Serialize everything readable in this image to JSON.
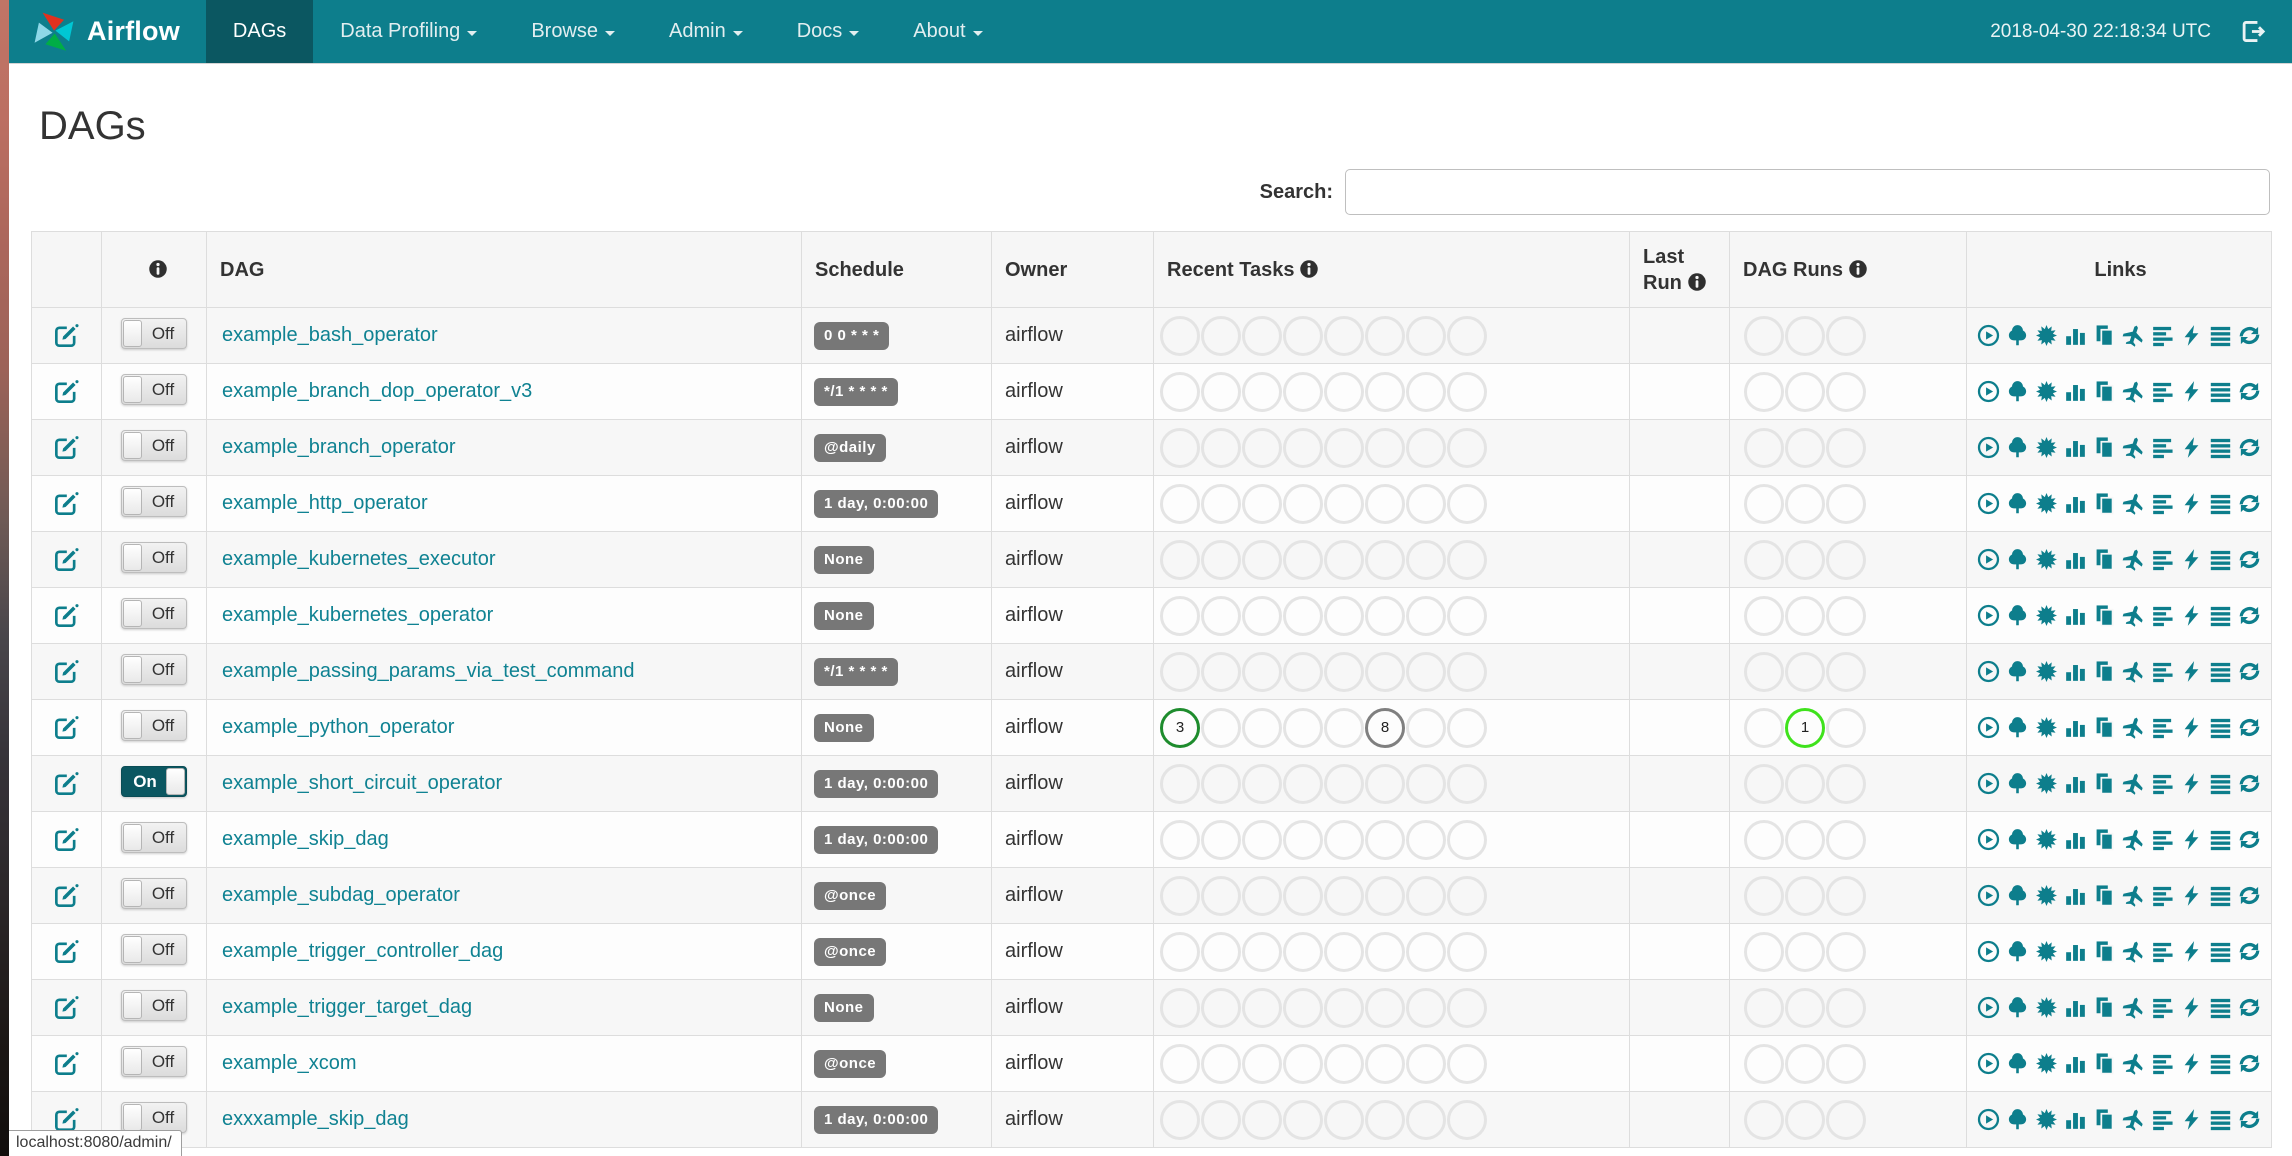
{
  "navbar": {
    "brand": "Airflow",
    "items": [
      {
        "label": "DAGs",
        "active": true,
        "dropdown": false
      },
      {
        "label": "Data Profiling",
        "active": false,
        "dropdown": true
      },
      {
        "label": "Browse",
        "active": false,
        "dropdown": true
      },
      {
        "label": "Admin",
        "active": false,
        "dropdown": true
      },
      {
        "label": "Docs",
        "active": false,
        "dropdown": true
      },
      {
        "label": "About",
        "active": false,
        "dropdown": true
      }
    ],
    "clock": "2018-04-30 22:18:34 UTC"
  },
  "page": {
    "title": "DAGs",
    "search_label": "Search:",
    "search_value": "",
    "status_bar": "localhost:8080/admin/"
  },
  "table": {
    "headers": {
      "dag": "DAG",
      "schedule": "Schedule",
      "owner": "Owner",
      "recent_tasks": "Recent Tasks",
      "last_run": "Last Run",
      "dag_runs": "DAG Runs",
      "links": "Links"
    },
    "recent_task_slots": 8,
    "dag_run_slots": 3,
    "rows": [
      {
        "name": "example_bash_operator",
        "schedule": "0 0 * * *",
        "owner": "airflow",
        "paused": true,
        "toggle_label": "Off",
        "last_run": "",
        "recent_tasks": [
          null,
          null,
          null,
          null,
          null,
          null,
          null,
          null
        ],
        "dag_runs": [
          null,
          null,
          null
        ]
      },
      {
        "name": "example_branch_dop_operator_v3",
        "schedule": "*/1 * * * *",
        "owner": "airflow",
        "paused": true,
        "toggle_label": "Off",
        "last_run": "",
        "recent_tasks": [
          null,
          null,
          null,
          null,
          null,
          null,
          null,
          null
        ],
        "dag_runs": [
          null,
          null,
          null
        ]
      },
      {
        "name": "example_branch_operator",
        "schedule": "@daily",
        "owner": "airflow",
        "paused": true,
        "toggle_label": "Off",
        "last_run": "",
        "recent_tasks": [
          null,
          null,
          null,
          null,
          null,
          null,
          null,
          null
        ],
        "dag_runs": [
          null,
          null,
          null
        ]
      },
      {
        "name": "example_http_operator",
        "schedule": "1 day, 0:00:00",
        "owner": "airflow",
        "paused": true,
        "toggle_label": "Off",
        "last_run": "",
        "recent_tasks": [
          null,
          null,
          null,
          null,
          null,
          null,
          null,
          null
        ],
        "dag_runs": [
          null,
          null,
          null
        ]
      },
      {
        "name": "example_kubernetes_executor",
        "schedule": "None",
        "owner": "airflow",
        "paused": true,
        "toggle_label": "Off",
        "last_run": "",
        "recent_tasks": [
          null,
          null,
          null,
          null,
          null,
          null,
          null,
          null
        ],
        "dag_runs": [
          null,
          null,
          null
        ]
      },
      {
        "name": "example_kubernetes_operator",
        "schedule": "None",
        "owner": "airflow",
        "paused": true,
        "toggle_label": "Off",
        "last_run": "",
        "recent_tasks": [
          null,
          null,
          null,
          null,
          null,
          null,
          null,
          null
        ],
        "dag_runs": [
          null,
          null,
          null
        ]
      },
      {
        "name": "example_passing_params_via_test_command",
        "schedule": "*/1 * * * *",
        "owner": "airflow",
        "paused": true,
        "toggle_label": "Off",
        "last_run": "",
        "recent_tasks": [
          null,
          null,
          null,
          null,
          null,
          null,
          null,
          null
        ],
        "dag_runs": [
          null,
          null,
          null
        ]
      },
      {
        "name": "example_python_operator",
        "schedule": "None",
        "owner": "airflow",
        "paused": true,
        "toggle_label": "Off",
        "last_run": "",
        "recent_tasks": [
          {
            "count": 3,
            "state": "success",
            "color": "#1e8c2d"
          },
          null,
          null,
          null,
          null,
          {
            "count": 8,
            "state": "queued",
            "color": "#7f7f7f"
          },
          null,
          null
        ],
        "dag_runs": [
          null,
          {
            "count": 1,
            "state": "running",
            "color": "#3fe21c"
          },
          null
        ]
      },
      {
        "name": "example_short_circuit_operator",
        "schedule": "1 day, 0:00:00",
        "owner": "airflow",
        "paused": false,
        "toggle_label": "On",
        "last_run": "",
        "recent_tasks": [
          null,
          null,
          null,
          null,
          null,
          null,
          null,
          null
        ],
        "dag_runs": [
          null,
          null,
          null
        ]
      },
      {
        "name": "example_skip_dag",
        "schedule": "1 day, 0:00:00",
        "owner": "airflow",
        "paused": true,
        "toggle_label": "Off",
        "last_run": "",
        "recent_tasks": [
          null,
          null,
          null,
          null,
          null,
          null,
          null,
          null
        ],
        "dag_runs": [
          null,
          null,
          null
        ]
      },
      {
        "name": "example_subdag_operator",
        "schedule": "@once",
        "owner": "airflow",
        "paused": true,
        "toggle_label": "Off",
        "last_run": "",
        "recent_tasks": [
          null,
          null,
          null,
          null,
          null,
          null,
          null,
          null
        ],
        "dag_runs": [
          null,
          null,
          null
        ]
      },
      {
        "name": "example_trigger_controller_dag",
        "schedule": "@once",
        "owner": "airflow",
        "paused": true,
        "toggle_label": "Off",
        "last_run": "",
        "recent_tasks": [
          null,
          null,
          null,
          null,
          null,
          null,
          null,
          null
        ],
        "dag_runs": [
          null,
          null,
          null
        ]
      },
      {
        "name": "example_trigger_target_dag",
        "schedule": "None",
        "owner": "airflow",
        "paused": true,
        "toggle_label": "Off",
        "last_run": "",
        "recent_tasks": [
          null,
          null,
          null,
          null,
          null,
          null,
          null,
          null
        ],
        "dag_runs": [
          null,
          null,
          null
        ]
      },
      {
        "name": "example_xcom",
        "schedule": "@once",
        "owner": "airflow",
        "paused": true,
        "toggle_label": "Off",
        "last_run": "",
        "recent_tasks": [
          null,
          null,
          null,
          null,
          null,
          null,
          null,
          null
        ],
        "dag_runs": [
          null,
          null,
          null
        ]
      },
      {
        "name": "exxxample_skip_dag",
        "schedule": "1 day, 0:00:00",
        "owner": "airflow",
        "paused": true,
        "toggle_label": "Off",
        "last_run": "",
        "recent_tasks": [
          null,
          null,
          null,
          null,
          null,
          null,
          null,
          null
        ],
        "dag_runs": [
          null,
          null,
          null
        ]
      }
    ]
  },
  "links": {
    "items": [
      {
        "name": "trigger-dag",
        "icon": "play-circle"
      },
      {
        "name": "tree-view",
        "icon": "tree"
      },
      {
        "name": "graph-view",
        "icon": "sunburst"
      },
      {
        "name": "task-duration",
        "icon": "bar-chart"
      },
      {
        "name": "task-tries",
        "icon": "duplicate"
      },
      {
        "name": "landing-times",
        "icon": "plane"
      },
      {
        "name": "gantt-view",
        "icon": "align-left"
      },
      {
        "name": "code-view",
        "icon": "bolt"
      },
      {
        "name": "logs",
        "icon": "align-justify"
      },
      {
        "name": "refresh",
        "icon": "refresh"
      }
    ]
  },
  "colors": {
    "navbar": "#0d7e8c",
    "navbar_active": "#0b5761",
    "link_teal": "#0f8292",
    "badge_gray": "#777777",
    "success_green": "#1e8c2d",
    "queued_gray": "#7f7f7f",
    "running_lime": "#3fe21c",
    "circle_default_border": "#e4e4e4"
  }
}
